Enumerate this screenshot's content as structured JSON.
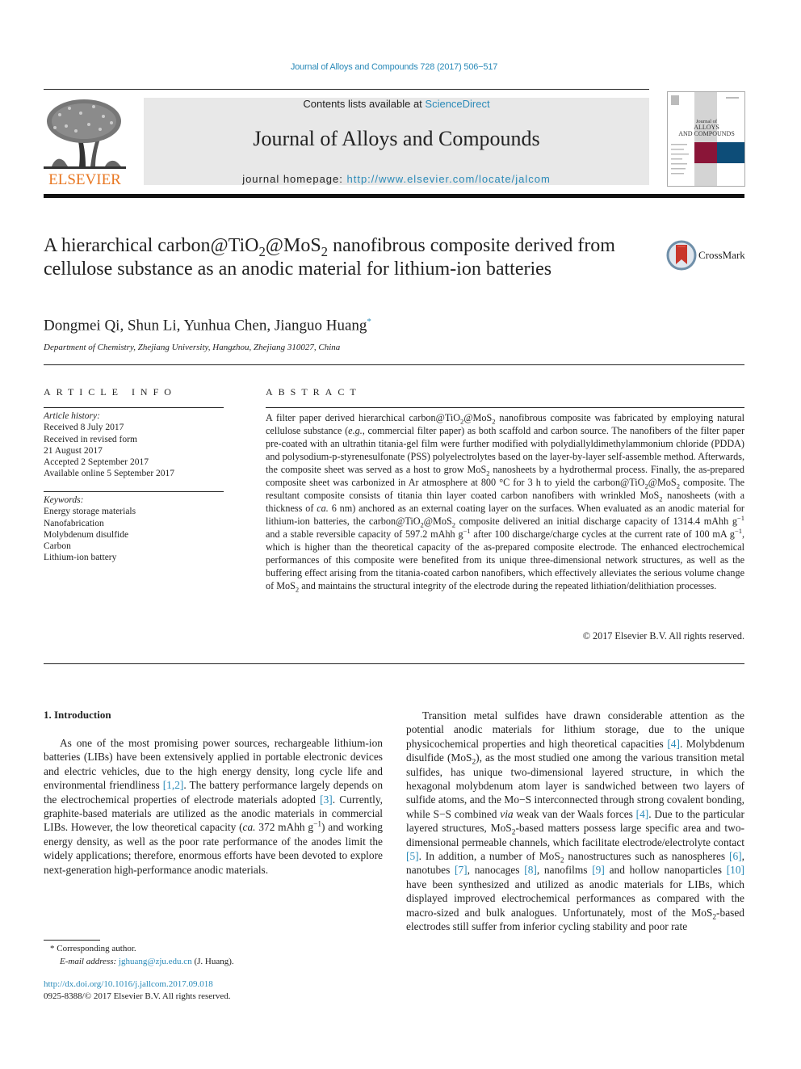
{
  "header": {
    "journal_citation": "Journal of Alloys and Compounds 728 (2017) 506−517",
    "contents_prefix": "Contents lists available at ",
    "contents_link": "ScienceDirect",
    "journal_name": "Journal of Alloys and Compounds",
    "homepage_prefix": "journal homepage: ",
    "homepage_url": "http://www.elsevier.com/locate/jalcom",
    "publisher_logo_text": "ELSEVIER",
    "cover": {
      "title_line1": "Journal of",
      "title_line2": "ALLOYS",
      "title_line3": "AND COMPOUNDS",
      "colors": [
        "#8a1538",
        "#0d4d78"
      ]
    }
  },
  "article": {
    "title_parts": {
      "p1": "A hierarchical carbon@TiO",
      "s1": "2",
      "p2": "@MoS",
      "s2": "2",
      "p3": " nanofibrous composite derived from cellulose substance as an anodic material for lithium-ion batteries"
    },
    "crossmark_label": "CrossMark",
    "authors": "Dongmei Qi, Shun Li, Yunhua Chen, Jianguo Huang",
    "corresponding_marker": "*",
    "affiliation": "Department of Chemistry, Zhejiang University, Hangzhou, Zhejiang 310027, China"
  },
  "article_info": {
    "heading": "ARTICLE INFO",
    "history_label": "Article history:",
    "history": [
      "Received 8 July 2017",
      "Received in revised form",
      "21 August 2017",
      "Accepted 2 September 2017",
      "Available online 5 September 2017"
    ],
    "keywords_label": "Keywords:",
    "keywords": [
      "Energy storage materials",
      "Nanofabrication",
      "Molybdenum disulfide",
      "Carbon",
      "Lithium-ion battery"
    ]
  },
  "abstract": {
    "heading": "ABSTRACT",
    "t1": "A filter paper derived hierarchical carbon@TiO",
    "t2": "@MoS",
    "t3": " nanofibrous composite was fabricated by employing natural cellulose substance (",
    "t3i": "e.g.",
    "t4": ", commercial filter paper) as both scaffold and carbon source. The nanofibers of the filter paper pre-coated with an ultrathin titania-gel film were further modified with polydiallyldimethylammonium chloride (PDDA) and polysodium-p-styrenesulfonate (PSS) polyelectrolytes based on the layer-by-layer self-assemble method. Afterwards, the composite sheet was served as a host to grow MoS",
    "t5": " nanosheets by a hydrothermal process. Finally, the as-prepared composite sheet was carbonized in Ar atmosphere at 800 °C for 3 h to yield the carbon@TiO",
    "t6": "@MoS",
    "t7": " composite. The resultant composite consists of titania thin layer coated carbon nanofibers with wrinkled MoS",
    "t8": " nanosheets (with a thickness of ",
    "t8i": "ca.",
    "t9": " 6 nm) anchored as an external coating layer on the surfaces. When evaluated as an anodic material for lithium-ion batteries, the carbon@TiO",
    "t10": "@MoS",
    "t11": " composite delivered an initial discharge capacity of 1314.4 mAhh g",
    "t12": " and a stable reversible capacity of 597.2 mAhh g",
    "t13": " after 100 discharge/charge cycles at the current rate of 100 mA g",
    "t14": ", which is higher than the theoretical capacity of the as-prepared composite electrode. The enhanced electrochemical performances of this composite were benefited from its unique three-dimensional network structures, as well as the buffering effect arising from the titania-coated carbon nanofibers, which effectively alleviates the serious volume change of MoS",
    "t15": " and maintains the structural integrity of the electrode during the repeated lithiation/delithiation processes.",
    "sub": "2",
    "sup": "−1",
    "copyright": "© 2017 Elsevier B.V. All rights reserved."
  },
  "introduction": {
    "heading": "1.  Introduction",
    "left": {
      "a": "As one of the most promising power sources, rechargeable lithium-ion batteries (LIBs) have been extensively applied in portable electronic devices and electric vehicles, due to the high energy density, long cycle life and environmental friendliness ",
      "ref_a": "[1,2]",
      "b": ". The battery performance largely depends on the electrochemical properties of electrode materials adopted ",
      "ref_b": "[3]",
      "c": ". Currently, graphite-based materials are utilized as the anodic materials in commercial LIBs. However, the low theoretical capacity (",
      "ci": "ca.",
      "d": " 372 mAhh g",
      "e": ") and working energy density, as well as the poor rate performance of the anodes limit the widely applications; therefore, enormous efforts have been devoted to explore next-generation high-performance anodic materials."
    },
    "right": {
      "a": "Transition metal sulfides have drawn considerable attention as the potential anodic materials for lithium storage, due to the unique physicochemical properties and high theoretical capacities ",
      "ref_4": "[4]",
      "b": ". Molybdenum disulfide (MoS",
      "c": "), as the most studied one among the various transition metal sulfides, has unique two-dimensional layered structure, in which the hexagonal molybdenum atom layer is sandwiched between two layers of sulfide atoms, and the Mo−S interconnected through strong covalent bonding, while S−S combined ",
      "ci": "via",
      "d": " weak van der Waals forces ",
      "e": ". Due to the particular layered structures, MoS",
      "f": "-based matters possess large specific area and two-dimensional permeable channels, which facilitate electrode/electrolyte contact ",
      "ref_5": "[5]",
      "g": ". In addition, a number of MoS",
      "h": " nanostructures such as nanospheres ",
      "ref_6": "[6]",
      "i": ", nanotubes ",
      "ref_7": "[7]",
      "j": ", nanocages ",
      "ref_8": "[8]",
      "k": ", nanofilms ",
      "ref_9": "[9]",
      "l": " and hollow nanoparticles ",
      "ref_10": "[10]",
      "m": " have been synthesized and utilized as anodic materials for LIBs, which displayed improved electrochemical performances as compared with the macro-sized and bulk analogues. Unfortunately, most of the MoS",
      "n": "-based electrodes still suffer from inferior cycling stability and poor rate"
    }
  },
  "footnotes": {
    "marker": "*",
    "corresponding": "Corresponding author.",
    "email_label": "E-mail address: ",
    "email": "jghuang@zju.edu.cn",
    "email_suffix": " (J. Huang).",
    "doi": "http://dx.doi.org/10.1016/j.jallcom.2017.09.018",
    "issn_copyright": "0925-8388/© 2017 Elsevier B.V. All rights reserved."
  }
}
